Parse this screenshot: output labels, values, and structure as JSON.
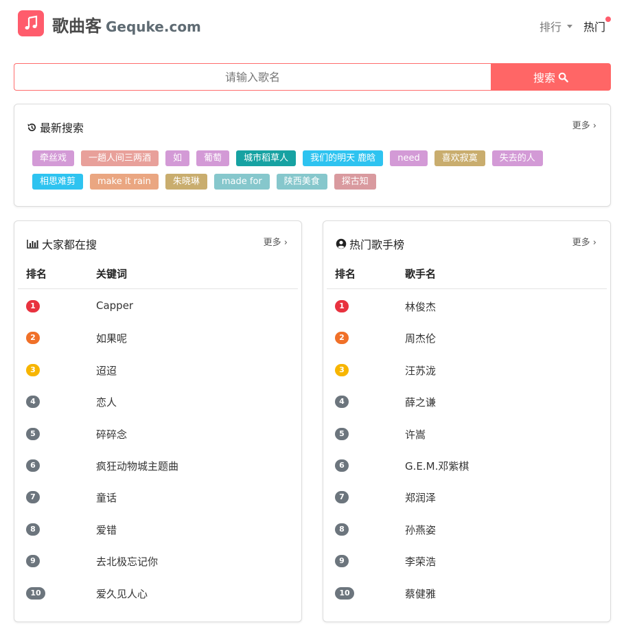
{
  "header": {
    "brand_name": "歌曲客",
    "brand_domain": "Gequke.com",
    "nav_rank": "排行",
    "nav_hot": "热门",
    "logo_color": "#ff5c6c"
  },
  "search": {
    "placeholder": "请输入歌名",
    "button_label": "搜索",
    "accent": "#ff6666"
  },
  "recent": {
    "title": "最新搜索",
    "more": "更多",
    "tags": [
      {
        "label": "牵丝戏",
        "color": "#d39ad6"
      },
      {
        "label": "一趟人间三两酒",
        "color": "#e8a09a"
      },
      {
        "label": "如",
        "color": "#d39ad6"
      },
      {
        "label": "葡萄",
        "color": "#d39ad6"
      },
      {
        "label": "城市稻草人",
        "color": "#17a2a2"
      },
      {
        "label": "我们的明天 鹿晗",
        "color": "#2ec3f0"
      },
      {
        "label": "need",
        "color": "#d39ad6"
      },
      {
        "label": "喜欢寂寞",
        "color": "#c9ad6e"
      },
      {
        "label": "失去的人",
        "color": "#d39ad6"
      },
      {
        "label": "相思难剪",
        "color": "#2ec3f0"
      },
      {
        "label": "make it rain",
        "color": "#eaa681"
      },
      {
        "label": "朱晓琳",
        "color": "#c9ad6e"
      },
      {
        "label": "made for",
        "color": "#86c7cc"
      },
      {
        "label": "陕西美食",
        "color": "#86c7cc"
      },
      {
        "label": "探古知",
        "color": "#d99a9f"
      }
    ]
  },
  "popular": {
    "title": "大家都在搜",
    "more": "更多",
    "col_rank": "排名",
    "col_keyword": "关键词",
    "rows": [
      {
        "rank": "1",
        "name": "Capper"
      },
      {
        "rank": "2",
        "name": "如果呢"
      },
      {
        "rank": "3",
        "name": "迢迢"
      },
      {
        "rank": "4",
        "name": "恋人"
      },
      {
        "rank": "5",
        "name": "碎碎念"
      },
      {
        "rank": "6",
        "name": "疯狂动物城主题曲"
      },
      {
        "rank": "7",
        "name": "童话"
      },
      {
        "rank": "8",
        "name": "爱错"
      },
      {
        "rank": "9",
        "name": "去北极忘记你"
      },
      {
        "rank": "10",
        "name": "爱久见人心"
      }
    ]
  },
  "singers": {
    "title": "热门歌手榜",
    "more": "更多",
    "col_rank": "排名",
    "col_singer": "歌手名",
    "rows": [
      {
        "rank": "1",
        "name": "林俊杰"
      },
      {
        "rank": "2",
        "name": "周杰伦"
      },
      {
        "rank": "3",
        "name": "汪苏泷"
      },
      {
        "rank": "4",
        "name": "薛之谦"
      },
      {
        "rank": "5",
        "name": "许嵩"
      },
      {
        "rank": "6",
        "name": "G.E.M.邓紫棋"
      },
      {
        "rank": "7",
        "name": "郑润泽"
      },
      {
        "rank": "8",
        "name": "孙燕姿"
      },
      {
        "rank": "9",
        "name": "李荣浩"
      },
      {
        "rank": "10",
        "name": "蔡健雅"
      }
    ]
  },
  "rank_colors": {
    "1": "#e8323f",
    "2": "#f07028",
    "3": "#f7b500",
    "default": "#6c757d"
  }
}
